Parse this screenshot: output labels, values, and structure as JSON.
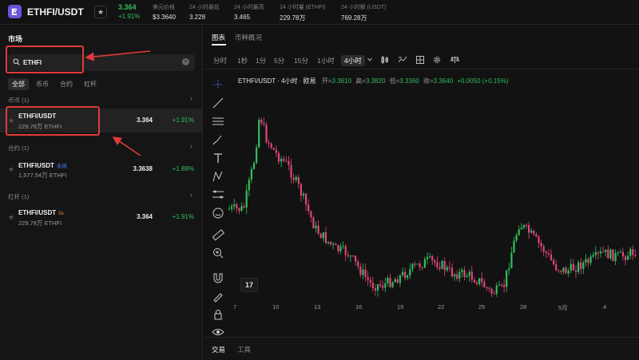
{
  "header": {
    "pair": "ETHFI/USDT",
    "price": "3.364",
    "change": "+1.91%",
    "stats": [
      {
        "label": "美元价格",
        "value": "$3.3640"
      },
      {
        "label": "24 小时最低",
        "value": "3.228"
      },
      {
        "label": "24 小时最高",
        "value": "3.465"
      },
      {
        "label": "24 小时量 (ETHFI)",
        "value": "229.78万"
      },
      {
        "label": "24 小时额 (USDT)",
        "value": "769.28万"
      }
    ]
  },
  "market": {
    "title": "市场",
    "search_value": "ETHFI",
    "categories": [
      "全部",
      "币币",
      "合约",
      "杠杆"
    ],
    "sections": [
      {
        "title": "币币 (1)",
        "rows": [
          {
            "symbol": "ETHFI/USDT",
            "tag": "",
            "volume": "229.78万 ETHFI",
            "price": "3.364",
            "change": "+1.91%"
          }
        ]
      },
      {
        "title": "合约 (1)",
        "rows": [
          {
            "symbol": "ETHFIUSDT",
            "tag": "永续",
            "volume": "1,577.54万 ETHFI",
            "price": "3.3638",
            "change": "+1.88%"
          }
        ]
      },
      {
        "title": "杠杆 (1)",
        "rows": [
          {
            "symbol": "ETHFI/USDT",
            "tag": "5x",
            "volume": "229.78万 ETHFI",
            "price": "3.364",
            "change": "+1.91%"
          }
        ]
      }
    ]
  },
  "chart_panel": {
    "tabs": [
      "图表",
      "币种概况"
    ],
    "timeframes": [
      "分时",
      "1秒",
      "1分",
      "5分",
      "15分",
      "1小时",
      "4小时"
    ],
    "selected_timeframe": "4小时",
    "legend_name": "ETHFI/USDT · 4小时 · 欧易",
    "ohlc": [
      {
        "k": "开=",
        "v": "3.3610"
      },
      {
        "k": "高=",
        "v": "3.3820"
      },
      {
        "k": "低=",
        "v": "3.3360"
      },
      {
        "k": "收=",
        "v": "3.3640"
      },
      {
        "k": "",
        "v": "+0.0050 (+0.15%)"
      }
    ],
    "tv_logo": "17",
    "bottom_tabs": [
      "交易",
      "工具"
    ]
  },
  "chart_data": {
    "type": "candlestick",
    "x_tick_labels": [
      "7",
      "10",
      "13",
      "16",
      "19",
      "22",
      "25",
      "28",
      "5月",
      "4"
    ],
    "colors": {
      "up": "#2fbf5c",
      "down": "#e0457b"
    }
  },
  "colors": {
    "accent_green": "#2fbf5c",
    "accent_red": "#e0457b",
    "highlight_box": "#e23a3a",
    "logo": "#6e52d8"
  }
}
